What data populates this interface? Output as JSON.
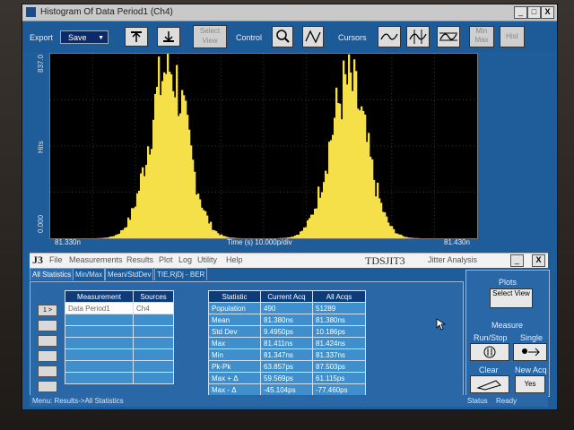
{
  "window": {
    "title": "Histogram Of Data Period1 (Ch4)",
    "min": "_",
    "max": "□",
    "close": "X"
  },
  "toolbar": {
    "export_label": "Export",
    "save_value": "Save",
    "select_view": "Select View",
    "control_label": "Control",
    "cursors_label": "Cursors",
    "minmax": "Min Max",
    "hist_btn": "Hist"
  },
  "plot": {
    "ylabel": "Hits",
    "ymax_label": "837.0",
    "ymin_label": "0.000",
    "xmin_label": "81.330n",
    "xmax_label": "81.430n",
    "xlabel": "Time (s)   10.000p/div",
    "accent": "#f5e04a"
  },
  "chart_data": {
    "type": "bar",
    "xlabel": "Time (s)",
    "ylabel": "Hits",
    "xlim": [
      81.33,
      81.43
    ],
    "ylim": [
      0,
      837
    ],
    "x_units": "ns",
    "grid": true,
    "peaks": [
      {
        "center": 81.3577,
        "sigma": 0.0044,
        "height": 820
      },
      {
        "center": 81.3998,
        "sigma": 0.0044,
        "height": 740
      }
    ]
  },
  "menu": {
    "logo": "J3",
    "items": [
      "File",
      "Measurements",
      "Results",
      "Plot",
      "Log",
      "Utility",
      "Help"
    ],
    "app_name": "TDSJIT3",
    "subtitle": "Jitter Analysis",
    "min": "_",
    "close": "X"
  },
  "tabs": [
    "All Statistics",
    "Min/Max",
    "Mean/StdDev",
    "TIE,RjDj - BER"
  ],
  "measurements": {
    "headers": [
      "Measurement",
      "Sources"
    ],
    "rows": [
      [
        "Data Period1",
        "Ch4"
      ],
      [
        "",
        ""
      ],
      [
        "",
        ""
      ],
      [
        "",
        ""
      ],
      [
        "",
        ""
      ],
      [
        "",
        ""
      ],
      [
        "",
        ""
      ]
    ],
    "row_btn_first": "1 >"
  },
  "statistics": {
    "headers": [
      "Statistic",
      "Current Acq",
      "All Acqs"
    ],
    "rows": [
      [
        "Population",
        "490",
        "51289"
      ],
      [
        "Mean",
        "81.380ns",
        "81.380ns"
      ],
      [
        "Std Dev",
        "9.4950ps",
        "10.186ps"
      ],
      [
        "Max",
        "81.411ns",
        "81.424ns"
      ],
      [
        "Min",
        "81.347ns",
        "81.337ns"
      ],
      [
        "Pk-Pk",
        "63.857ps",
        "87.503ps"
      ],
      [
        "Max + Δ",
        "59.569ps",
        "61.115ps"
      ],
      [
        "Max - Δ",
        "-45.104ps",
        "-77.460ps"
      ]
    ]
  },
  "right_panel": {
    "plots_label": "Plots",
    "select_view": "Select View",
    "measure_label": "Measure",
    "run_stop": "Run/Stop",
    "single": "Single",
    "clear": "Clear",
    "new_acq": "New Acq",
    "yes": "Yes"
  },
  "status": {
    "menu_path": "Menu: Results->All Statistics",
    "status_label": "Status",
    "status_value": "Ready"
  }
}
